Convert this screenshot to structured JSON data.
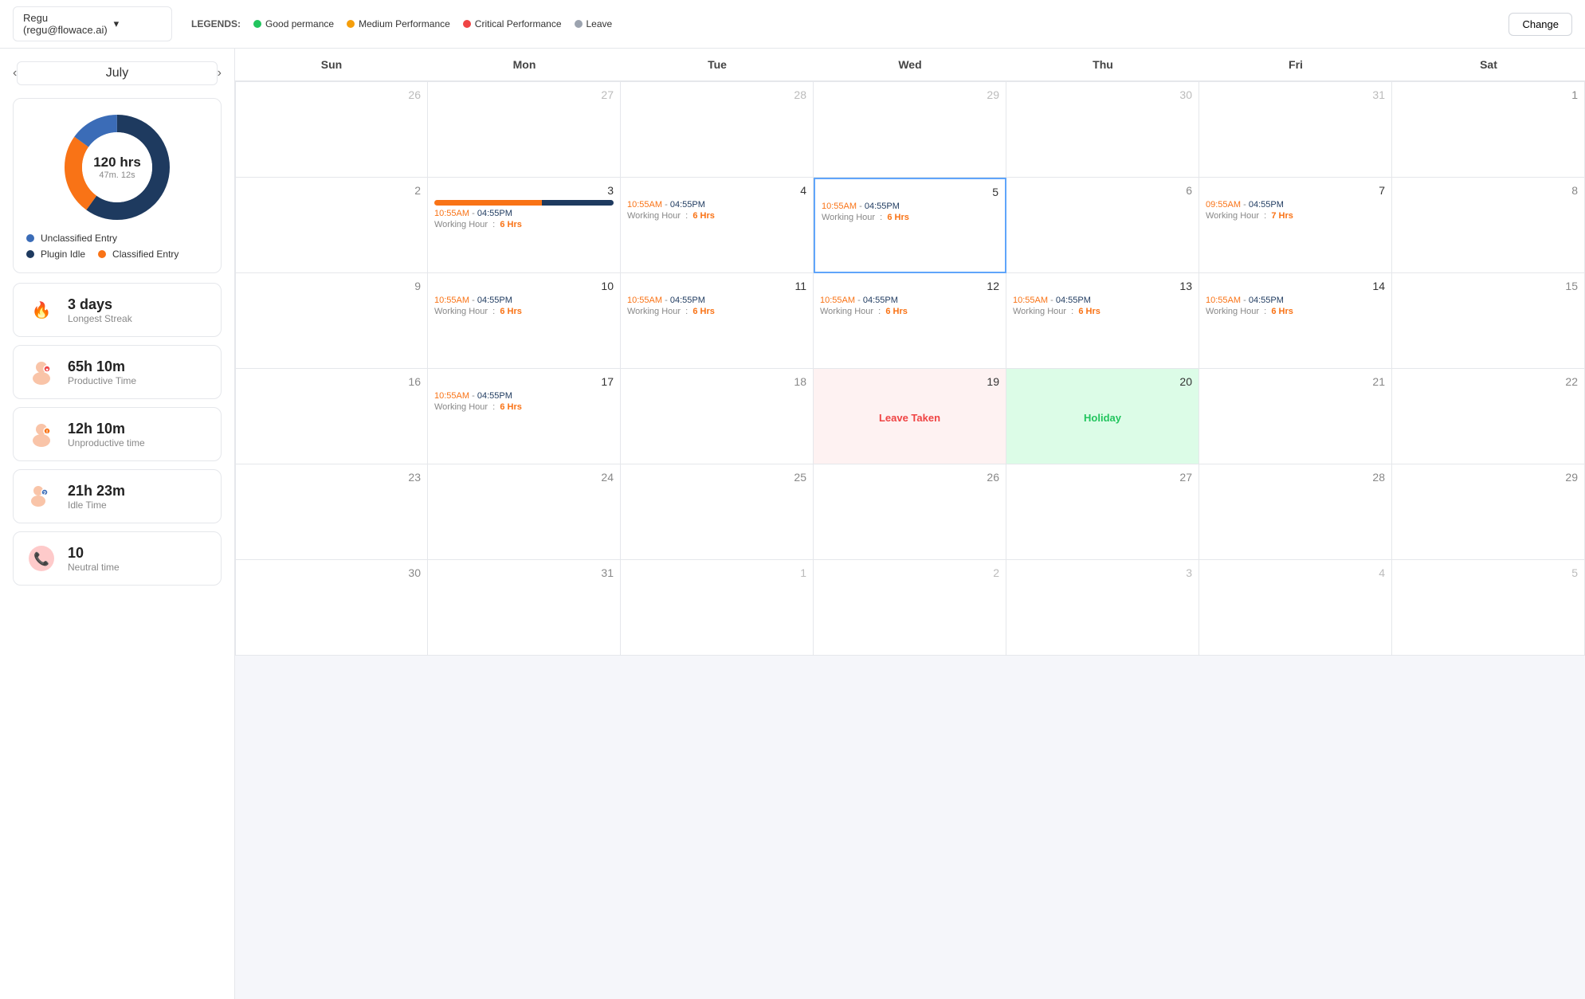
{
  "header": {
    "user": "Regu (regu@flowace.ai)",
    "legends_label": "LEGENDS:",
    "legends": [
      {
        "label": "Good permance",
        "color": "green"
      },
      {
        "label": "Medium Performance",
        "color": "yellow"
      },
      {
        "label": "Critical Performance",
        "color": "red"
      },
      {
        "label": "Leave",
        "color": "gray"
      }
    ],
    "change_btn": "Change"
  },
  "sidebar": {
    "month": "July",
    "chart": {
      "hrs": "120 hrs",
      "mins": "47m. 12s",
      "legends": [
        {
          "label": "Unclassified Entry",
          "color": "#3b6cb7"
        },
        {
          "label": "Plugin Idle",
          "color": "#1e3a5f"
        },
        {
          "label": "Classified Entry",
          "color": "#f97316"
        }
      ]
    },
    "stats": [
      {
        "icon": "🔥",
        "value": "3 days",
        "label": "Longest Streak"
      },
      {
        "icon": "👤",
        "value": "65h 10m",
        "label": "Productive Time"
      },
      {
        "icon": "👤",
        "value": "12h 10m",
        "label": "Unproductive time"
      },
      {
        "icon": "👤",
        "value": "21h 23m",
        "label": "Idle Time"
      },
      {
        "icon": "📞",
        "value": "10",
        "label": "Neutral time"
      }
    ]
  },
  "calendar": {
    "headers": [
      "Sun",
      "Mon",
      "Tue",
      "Wed",
      "Thu",
      "Fri",
      "Sat"
    ],
    "weeks": [
      [
        {
          "date": "26",
          "other": true
        },
        {
          "date": "27",
          "other": true
        },
        {
          "date": "28",
          "other": true
        },
        {
          "date": "29",
          "other": true
        },
        {
          "date": "30",
          "other": true
        },
        {
          "date": "31",
          "other": true
        },
        {
          "date": "1"
        }
      ],
      [
        {
          "date": "2"
        },
        {
          "date": "3",
          "has_bar": true,
          "time_start": "10:55AM",
          "time_end": "04:55PM",
          "working_hrs": "6 Hrs"
        },
        {
          "date": "4",
          "time_start": "10:55AM",
          "time_end": "04:55PM",
          "working_hrs": "6 Hrs"
        },
        {
          "date": "5",
          "today": true,
          "time_start": "10:55AM",
          "time_end": "04:55PM",
          "working_hrs": "6 Hrs"
        },
        {
          "date": "6"
        },
        {
          "date": "7",
          "time_start": "09:55AM",
          "time_end": "04:55PM",
          "working_hrs": "7 Hrs"
        },
        {
          "date": "8"
        }
      ],
      [
        {
          "date": "9"
        },
        {
          "date": "10",
          "time_start": "10:55AM",
          "time_end": "04:55PM",
          "working_hrs": "6 Hrs"
        },
        {
          "date": "11",
          "time_start": "10:55AM",
          "time_end": "04:55PM",
          "working_hrs": "6 Hrs"
        },
        {
          "date": "12",
          "time_start": "10:55AM",
          "time_end": "04:55PM",
          "working_hrs": "6 Hrs"
        },
        {
          "date": "13",
          "time_start": "10:55AM",
          "time_end": "04:55PM",
          "working_hrs": "6 Hrs"
        },
        {
          "date": "14",
          "time_start": "10:55AM",
          "time_end": "04:55PM",
          "working_hrs": "6 Hrs"
        },
        {
          "date": "15"
        }
      ],
      [
        {
          "date": "16"
        },
        {
          "date": "17",
          "time_start": "10:55AM",
          "time_end": "04:55PM",
          "working_hrs": "6 Hrs"
        },
        {
          "date": "18"
        },
        {
          "date": "19",
          "leave_taken": true,
          "label": "Leave Taken"
        },
        {
          "date": "20",
          "holiday": true,
          "label": "Holiday"
        },
        {
          "date": "21"
        },
        {
          "date": "22"
        }
      ],
      [
        {
          "date": "23"
        },
        {
          "date": "24"
        },
        {
          "date": "25"
        },
        {
          "date": "26"
        },
        {
          "date": "27"
        },
        {
          "date": "28"
        },
        {
          "date": "29"
        }
      ],
      [
        {
          "date": "30"
        },
        {
          "date": "31"
        },
        {
          "date": "1",
          "other": true
        },
        {
          "date": "2",
          "other": true
        },
        {
          "date": "3",
          "other": true
        },
        {
          "date": "4",
          "other": true
        },
        {
          "date": "5",
          "other": true
        }
      ]
    ]
  }
}
